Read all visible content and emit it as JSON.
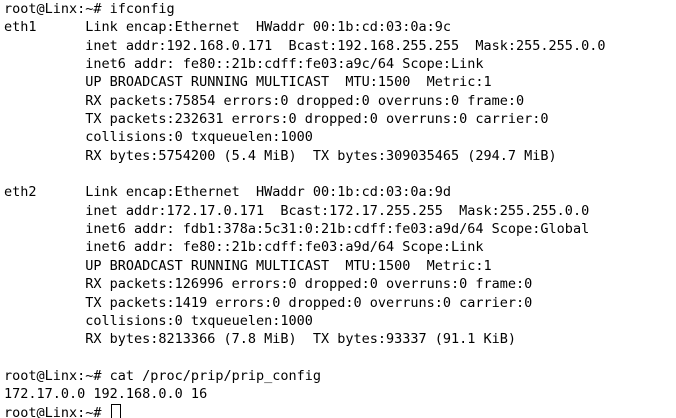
{
  "terminal": {
    "lines": [
      "root@Linx:~# ifconfig",
      "eth1      Link encap:Ethernet  HWaddr 00:1b:cd:03:0a:9c",
      "          inet addr:192.168.0.171  Bcast:192.168.255.255  Mask:255.255.0.0",
      "          inet6 addr: fe80::21b:cdff:fe03:a9c/64 Scope:Link",
      "          UP BROADCAST RUNNING MULTICAST  MTU:1500  Metric:1",
      "          RX packets:75854 errors:0 dropped:0 overruns:0 frame:0",
      "          TX packets:232631 errors:0 dropped:0 overruns:0 carrier:0",
      "          collisions:0 txqueuelen:1000",
      "          RX bytes:5754200 (5.4 MiB)  TX bytes:309035465 (294.7 MiB)",
      "",
      "eth2      Link encap:Ethernet  HWaddr 00:1b:cd:03:0a:9d",
      "          inet addr:172.17.0.171  Bcast:172.17.255.255  Mask:255.255.0.0",
      "          inet6 addr: fdb1:378a:5c31:0:21b:cdff:fe03:a9d/64 Scope:Global",
      "          inet6 addr: fe80::21b:cdff:fe03:a9d/64 Scope:Link",
      "          UP BROADCAST RUNNING MULTICAST  MTU:1500  Metric:1",
      "          RX packets:126996 errors:0 dropped:0 overruns:0 frame:0",
      "          TX packets:1419 errors:0 dropped:0 overruns:0 carrier:0",
      "          collisions:0 txqueuelen:1000",
      "          RX bytes:8213366 (7.8 MiB)  TX bytes:93337 (91.1 KiB)",
      "",
      "root@Linx:~# cat /proc/prip/prip_config",
      "172.17.0.0 192.168.0.0 16"
    ],
    "prompt": "root@Linx:~# "
  }
}
